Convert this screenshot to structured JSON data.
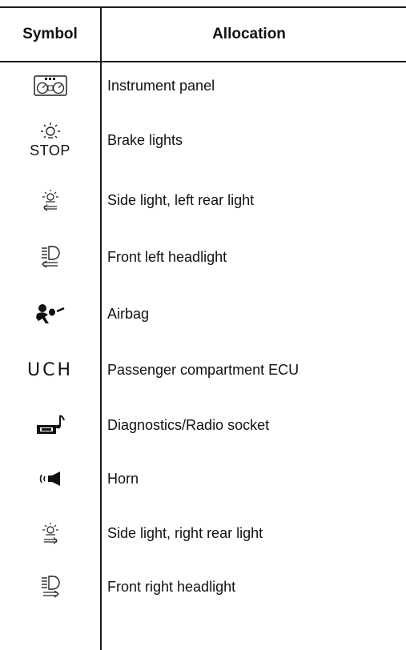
{
  "header": {
    "symbol": "Symbol",
    "allocation": "Allocation"
  },
  "rows": [
    {
      "icon": "instrument-panel-icon",
      "allocation": "Instrument panel"
    },
    {
      "icon": "brake-lights-icon",
      "symbol_text": "STOP",
      "allocation": "Brake lights"
    },
    {
      "icon": "side-light-left-icon",
      "allocation": "Side light, left rear light"
    },
    {
      "icon": "headlight-left-icon",
      "allocation": "Front left headlight"
    },
    {
      "icon": "airbag-icon",
      "allocation": "Airbag"
    },
    {
      "icon": "uch-label",
      "symbol_text": "UCH",
      "allocation": "Passenger compartment ECU"
    },
    {
      "icon": "radio-socket-icon",
      "allocation": "Diagnostics/Radio socket"
    },
    {
      "icon": "horn-icon",
      "allocation": "Horn"
    },
    {
      "icon": "side-light-right-icon",
      "allocation": "Side light, right rear light"
    },
    {
      "icon": "headlight-right-icon",
      "allocation": "Front right headlight"
    }
  ]
}
